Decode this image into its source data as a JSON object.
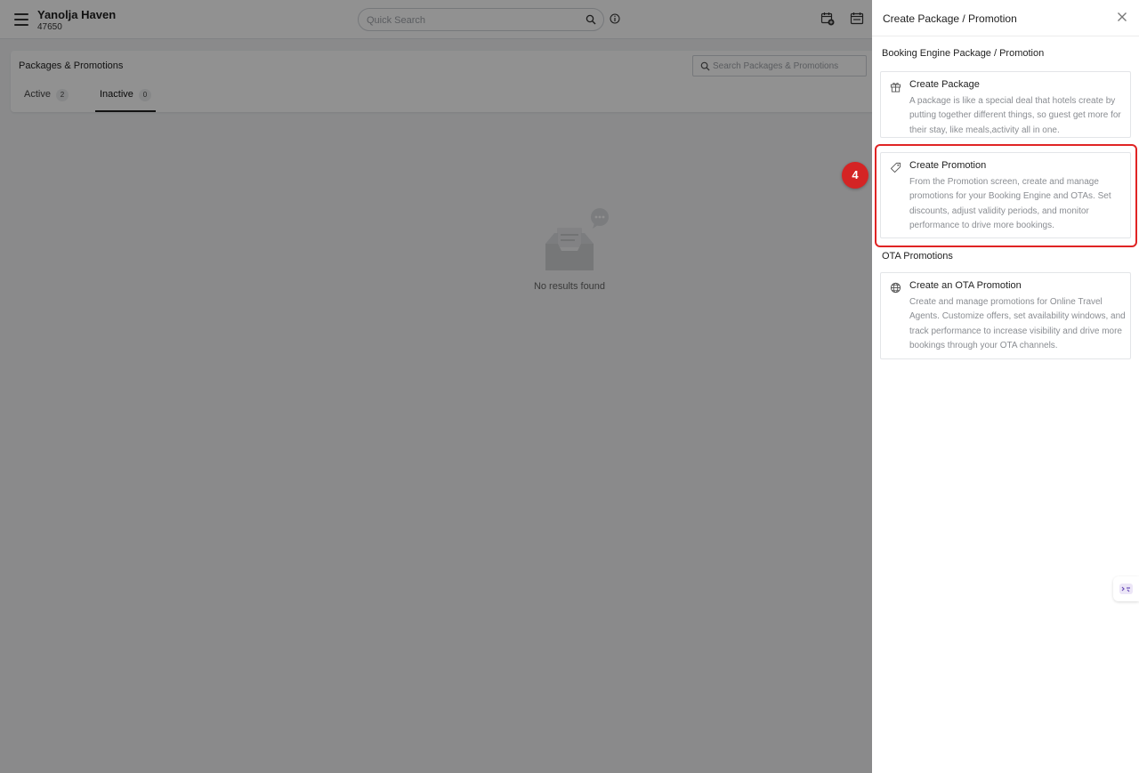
{
  "header": {
    "hotel_name": "Yanolja Haven",
    "hotel_id": "47650",
    "quick_search_placeholder": "Quick Search"
  },
  "page": {
    "title": "Packages & Promotions",
    "search_placeholder": "Search Packages & Promotions",
    "tabs": [
      {
        "label": "Active",
        "count": "2"
      },
      {
        "label": "Inactive",
        "count": "0"
      }
    ],
    "active_tab": "Inactive",
    "empty_text": "No results found"
  },
  "drawer": {
    "title": "Create Package / Promotion",
    "sections": [
      {
        "title": "Booking Engine Package / Promotion",
        "options": [
          {
            "icon": "gift-icon",
            "title": "Create Package",
            "description": "A package is like a special deal that hotels create by putting together different things, so guest get more for their stay, like meals,activity all in one."
          },
          {
            "icon": "tag-icon",
            "title": "Create Promotion",
            "description": "From the Promotion screen, create and manage promotions for your Booking Engine and OTAs. Set discounts, adjust validity periods, and monitor performance to drive more bookings."
          }
        ]
      },
      {
        "title": "OTA Promotions",
        "options": [
          {
            "icon": "globe-icon",
            "title": "Create an OTA Promotion",
            "description": "Create and manage promotions for Online Travel Agents. Customize offers, set availability windows, and track performance to increase visibility and drive more bookings through your OTA channels."
          }
        ]
      }
    ]
  },
  "annotation": {
    "step_number": "4",
    "highlight_color": "#e02424"
  },
  "colors": {
    "overlay": "rgba(0,0,0,0.43)",
    "step_badge": "#d42424"
  }
}
